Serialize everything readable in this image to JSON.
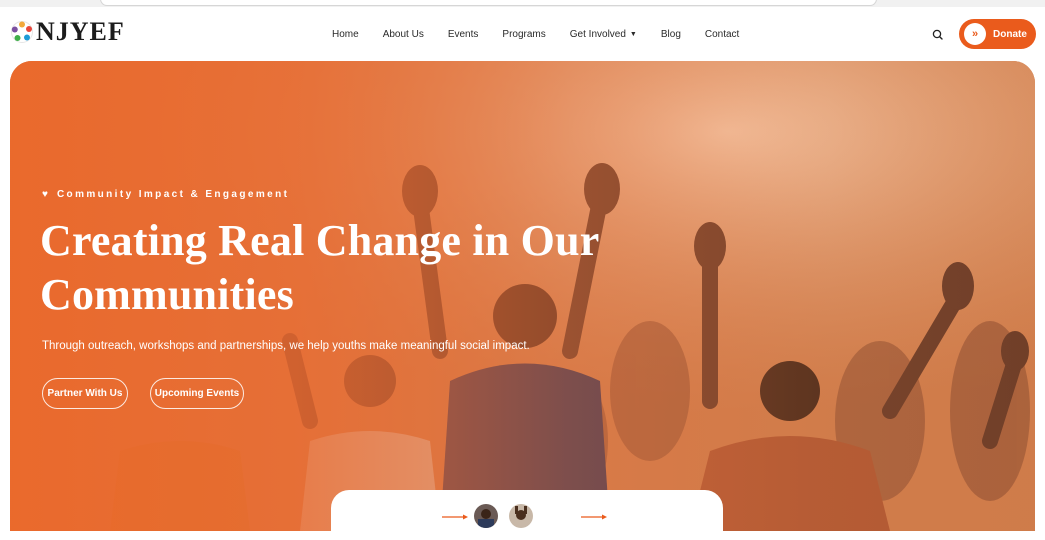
{
  "brand": {
    "name": "NJYEF"
  },
  "nav": {
    "items": [
      {
        "label": "Home"
      },
      {
        "label": "About Us"
      },
      {
        "label": "Events"
      },
      {
        "label": "Programs"
      },
      {
        "label": "Get Involved"
      },
      {
        "label": "Blog"
      },
      {
        "label": "Contact"
      }
    ],
    "donate_label": "Donate"
  },
  "hero": {
    "tagline": "Community Impact & Engagement",
    "title": "Creating Real Change in Our Communities",
    "subtitle": "Through outreach, workshops and partnerships, we help youths make meaningful social impact.",
    "cta_partner": "Partner With Us",
    "cta_events": "Upcoming Events"
  },
  "colors": {
    "accent": "#ea5b1c",
    "hero_overlay": "#ec682a",
    "text_dark": "#1c1c1c"
  },
  "icons": [
    "logo-mark-icon",
    "search-icon",
    "chevrons-right-icon",
    "heart-icon",
    "chevron-down-icon",
    "arrow-right-icon"
  ]
}
